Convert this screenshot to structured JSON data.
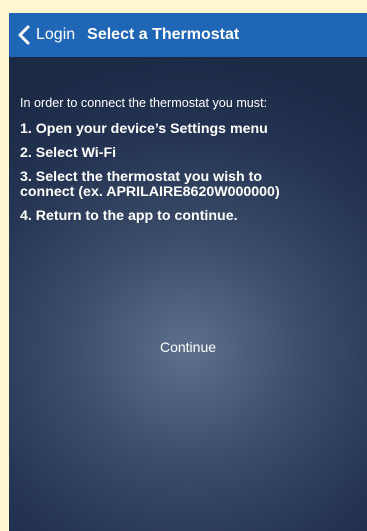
{
  "nav": {
    "back_label": "Login",
    "title": "Select a Thermostat",
    "back_icon": "chevron-left-icon"
  },
  "instructions": {
    "intro": "In order to connect the thermostat you must:",
    "steps": [
      "1. Open your device’s Settings menu",
      "2. Select Wi-Fi",
      "3. Select the thermostat you wish to\nconnect (ex. APRILAIRE8620W000000)",
      "4. Return to the app to continue."
    ]
  },
  "actions": {
    "continue_label": "Continue"
  },
  "colors": {
    "nav_bar": "#1f66b7",
    "background_top": "#1b2945",
    "background_center": "#5c6f8c",
    "outer_background": "#fdf6cf",
    "text": "#ffffff"
  }
}
